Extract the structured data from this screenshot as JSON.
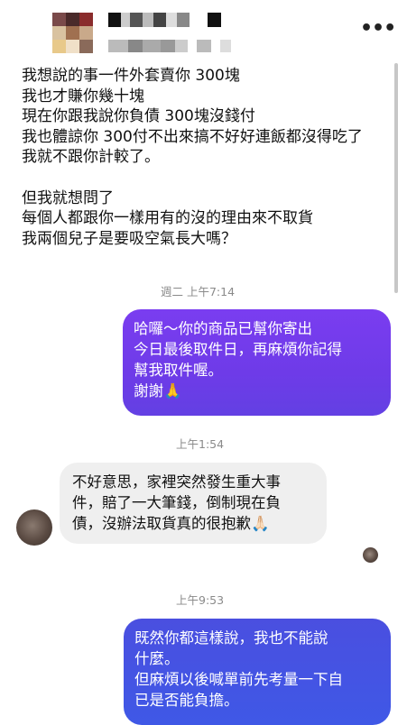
{
  "header": {
    "more_label": "•••"
  },
  "messages": [
    {
      "text": "我想說的事一件外套賣你 300塊\n我也才賺你幾十塊\n現在你跟我說你負債 300塊沒錢付\n我也體諒你 300付不出來搞不好好連飯都沒得吃了\n我就不跟你計較了。\n\n但我就想問了\n每個人都跟你一樣用有的沒的理由來不取貨\n我兩個兒子是要吸空氣長大嗎？"
    },
    {
      "time": "週二 上午7:14"
    },
    {
      "text": "哈囉～你的商品已幫你寄出\n今日最後取件日，再麻煩你記得\n幫我取件喔。\n謝謝🙏"
    },
    {
      "time": "上午1:54"
    },
    {
      "text": "不好意思，家裡突然發生重大事\n件，賠了一大筆錢，倒制現在負\n債，沒辦法取貨真的很抱歉🙏🏻"
    },
    {
      "time": "上午9:53"
    },
    {
      "text": "既然你都這樣說，我也不能說\n什麼。\n但麻煩以後喊單前先考量一下自\n已是否能負擔。"
    }
  ],
  "colors": {
    "outgoing": "#6e3be8",
    "outgoing_late": "#4455e4",
    "incoming": "#efefef"
  }
}
